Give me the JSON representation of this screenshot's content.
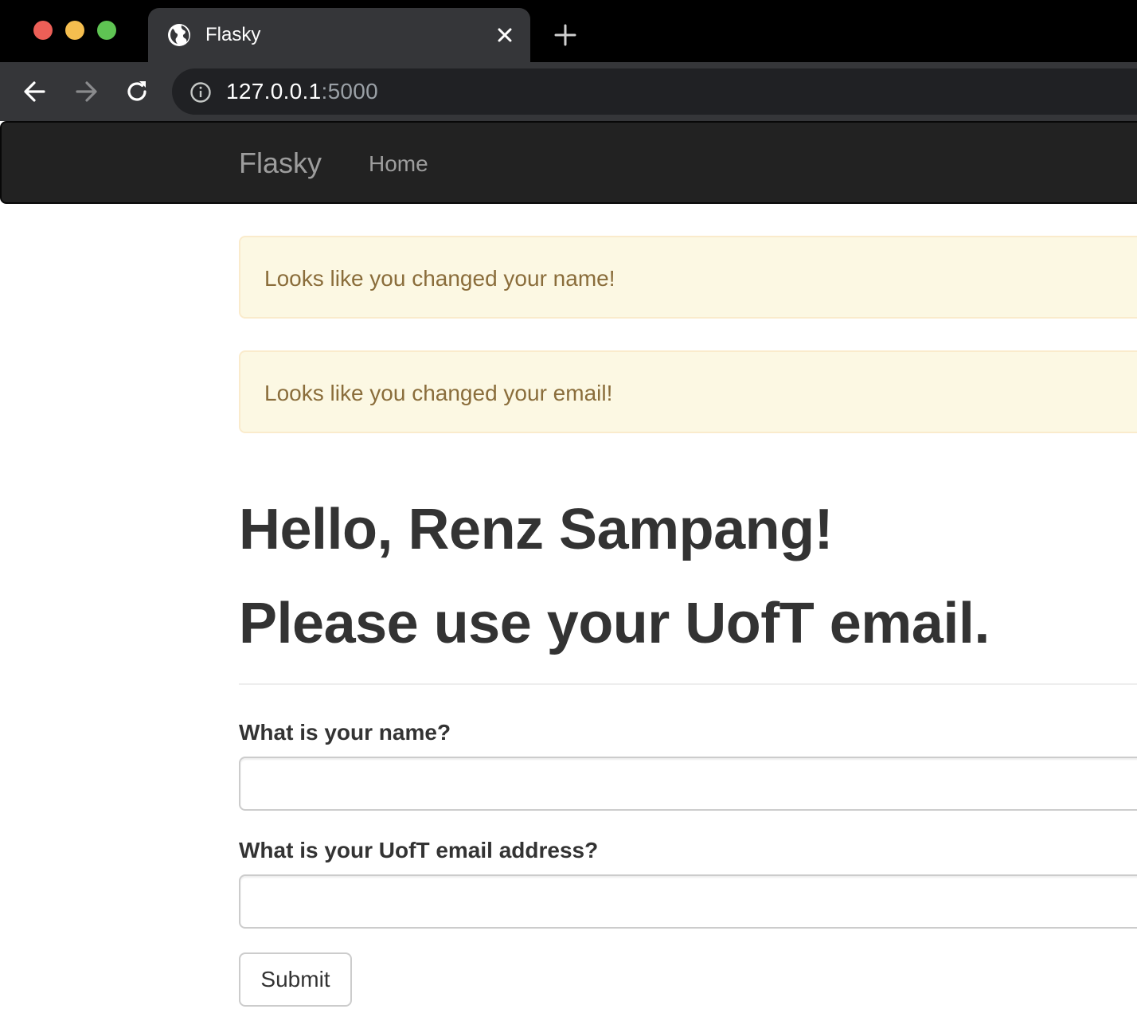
{
  "browser": {
    "tab": {
      "title": "Flasky",
      "favicon": "globe-icon"
    },
    "new_tab_icon": "plus-icon",
    "nav": {
      "back_icon": "arrow-left-icon",
      "forward_icon": "arrow-right-icon",
      "reload_icon": "reload-icon"
    },
    "address_bar": {
      "icon": "info-icon",
      "host": "127.0.0.1",
      "port": ":5000"
    },
    "window_controls": [
      "close",
      "minimize",
      "maximize"
    ],
    "colors": {
      "close": "#ec5f57",
      "minimize": "#f5be4f",
      "maximize": "#5fc453"
    }
  },
  "navbar": {
    "brand": "Flasky",
    "links": [
      {
        "label": "Home"
      }
    ]
  },
  "alerts": [
    {
      "text": "Looks like you changed your name!"
    },
    {
      "text": "Looks like you changed your email!"
    }
  ],
  "page_header": {
    "greeting": "Hello, Renz Sampang!",
    "message": "Please use your UofT email."
  },
  "form": {
    "name_label": "What is your name?",
    "name_value": "",
    "email_label": "What is your UofT email address?",
    "email_value": "",
    "submit_label": "Submit"
  },
  "colors": {
    "navbar_bg": "#222222",
    "alert_bg": "#fcf8e3",
    "alert_text": "#8a6d3b",
    "heading_text": "#333333"
  }
}
